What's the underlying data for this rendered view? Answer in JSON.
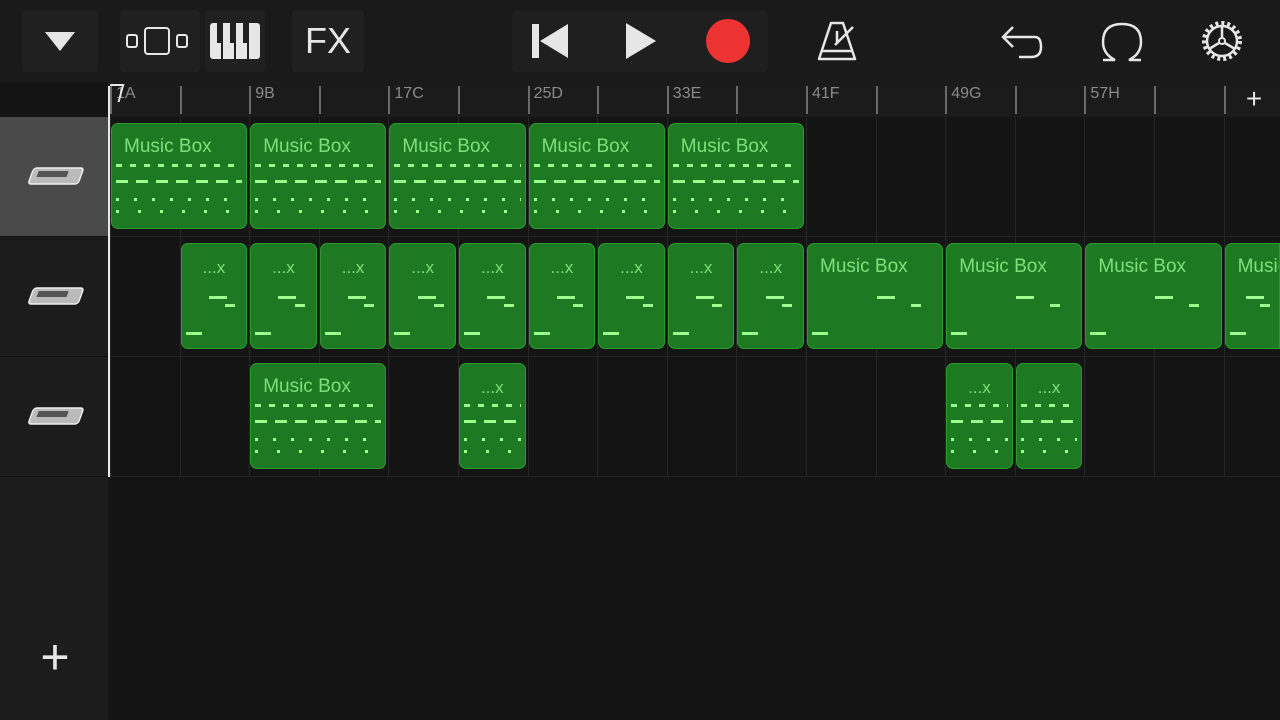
{
  "toolbar": {
    "browser_icon": "triangle-down-icon",
    "tracks_view_icon": "tracks-view-icon",
    "instrument_icon": "keyboard-icon",
    "fx_label": "FX",
    "go_to_start_icon": "skip-back-icon",
    "play_icon": "play-icon",
    "record_icon": "record-icon",
    "record_color": "#ee3333",
    "metronome_icon": "metronome-icon",
    "undo_icon": "undo-icon",
    "loop_icon": "loop-icon",
    "settings_icon": "gear-icon"
  },
  "ruler": {
    "markers": [
      {
        "bar": 1,
        "label": "1A"
      },
      {
        "bar": 9,
        "label": "9B"
      },
      {
        "bar": 17,
        "label": "17C"
      },
      {
        "bar": 25,
        "label": "25D"
      },
      {
        "bar": 33,
        "label": "33E"
      },
      {
        "bar": 41,
        "label": "41F"
      },
      {
        "bar": 49,
        "label": "49G"
      },
      {
        "bar": 57,
        "label": "57H"
      },
      {
        "bar": 65,
        "label": ""
      }
    ],
    "add_section_label": "+"
  },
  "region_color": "#1e7a22",
  "tracks": [
    {
      "instrument_icon": "keyboard-icon",
      "selected": true,
      "regions": [
        {
          "label": "Music Box",
          "start": 1,
          "length": 8
        },
        {
          "label": "Music Box",
          "start": 9,
          "length": 8
        },
        {
          "label": "Music Box",
          "start": 17,
          "length": 8
        },
        {
          "label": "Music Box",
          "start": 25,
          "length": 8
        },
        {
          "label": "Music Box",
          "start": 33,
          "length": 8
        }
      ]
    },
    {
      "instrument_icon": "keyboard-icon",
      "selected": false,
      "regions": [
        {
          "label": "...x",
          "start": 5,
          "length": 4
        },
        {
          "label": "...x",
          "start": 9,
          "length": 4
        },
        {
          "label": "...x",
          "start": 13,
          "length": 4
        },
        {
          "label": "...x",
          "start": 17,
          "length": 4
        },
        {
          "label": "...x",
          "start": 21,
          "length": 4
        },
        {
          "label": "...x",
          "start": 25,
          "length": 4
        },
        {
          "label": "...x",
          "start": 29,
          "length": 4
        },
        {
          "label": "...x",
          "start": 33,
          "length": 4
        },
        {
          "label": "...x",
          "start": 37,
          "length": 4
        },
        {
          "label": "Music Box",
          "start": 41,
          "length": 8
        },
        {
          "label": "Music Box",
          "start": 49,
          "length": 8
        },
        {
          "label": "Music Box",
          "start": 57,
          "length": 8
        },
        {
          "label": "Music Box",
          "start": 65,
          "length": 8
        }
      ]
    },
    {
      "instrument_icon": "keyboard-icon",
      "selected": false,
      "regions": [
        {
          "label": "Music Box",
          "start": 9,
          "length": 8
        },
        {
          "label": "...x",
          "start": 21,
          "length": 4
        },
        {
          "label": "...x",
          "start": 49,
          "length": 4
        },
        {
          "label": "...x",
          "start": 53,
          "length": 4
        }
      ]
    }
  ],
  "add_track_label": "+"
}
